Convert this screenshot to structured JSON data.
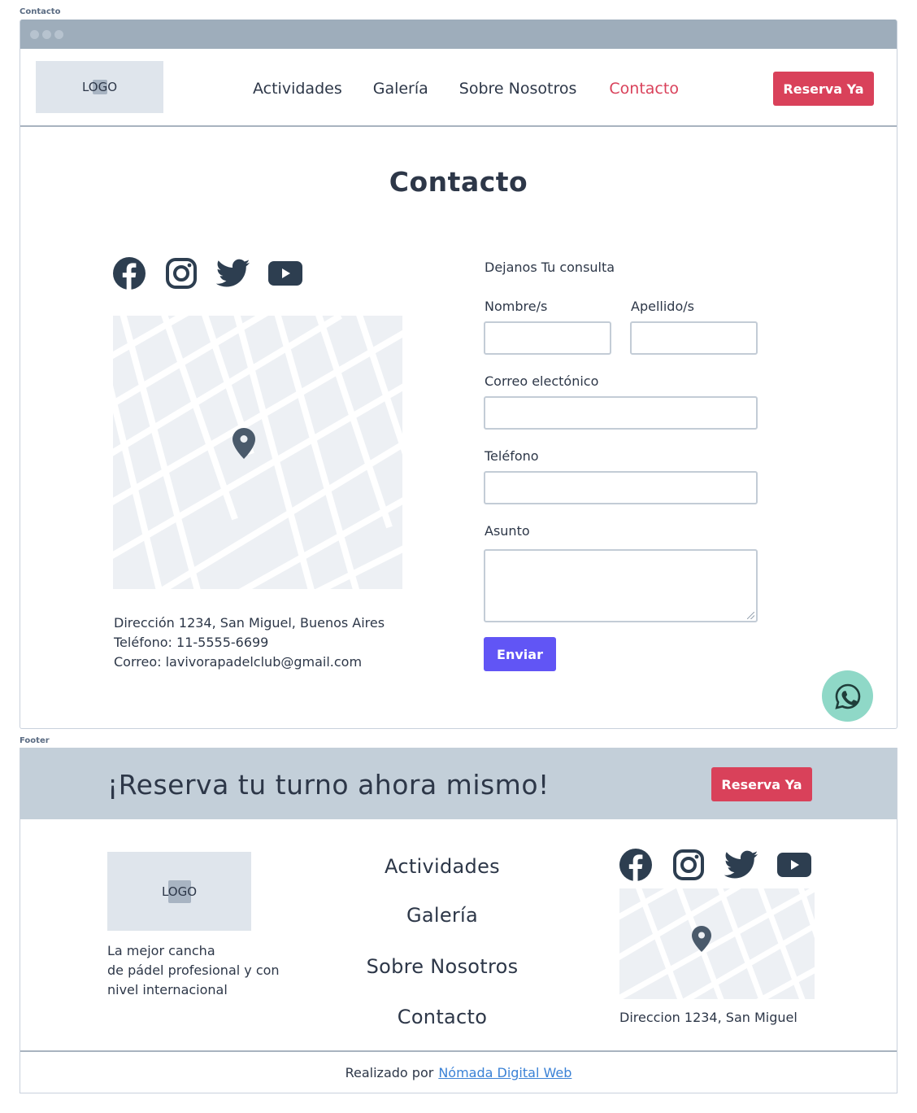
{
  "frames": {
    "contacto_label": "Contacto",
    "footer_label": "Footer"
  },
  "header": {
    "logo_text": "LOGO",
    "nav": [
      "Actividades",
      "Galería",
      "Sobre Nosotros",
      "Contacto"
    ],
    "active_nav": "Contacto",
    "cta_label": "Reserva Ya"
  },
  "main": {
    "title": "Contacto",
    "social_icons": [
      "facebook-icon",
      "instagram-icon",
      "twitter-icon",
      "youtube-icon"
    ],
    "map_icon": "map-pin-icon",
    "contact_info": {
      "address": "Dirección 1234, San Miguel, Buenos Aires",
      "phone": "Teléfono: 11-5555-6699",
      "email": "Correo: lavivorapadelclub@gmail.com"
    },
    "form": {
      "heading": "Dejanos Tu consulta",
      "first_name_label": "Nombre/s",
      "last_name_label": "Apellido/s",
      "email_label": "Correo electónico",
      "phone_label": "Teléfono",
      "subject_label": "Asunto",
      "first_name_value": "",
      "last_name_value": "",
      "email_value": "",
      "phone_value": "",
      "subject_value": "",
      "submit_label": "Enviar"
    },
    "whatsapp_icon": "whatsapp-icon"
  },
  "footer": {
    "cta_text": "¡Reserva tu turno ahora mismo!",
    "cta_button": "Reserva Ya",
    "logo_text": "LOGO",
    "description_lines": [
      "La mejor cancha",
      "de pádel profesional y con",
      "nivel internacional"
    ],
    "nav": [
      "Actividades",
      "Galería",
      "Sobre Nosotros",
      "Contacto"
    ],
    "address": "Direccion 1234, San Miguel",
    "credits_prefix": "Realizado por",
    "credits_link": "Nómada Digital Web"
  },
  "colors": {
    "accent_red": "#d9415a",
    "submit_purple": "#6155f5",
    "whatsapp_bg": "#8fd8c7",
    "cta_band": "#c3cfd9",
    "link_blue": "#3b82d6"
  }
}
